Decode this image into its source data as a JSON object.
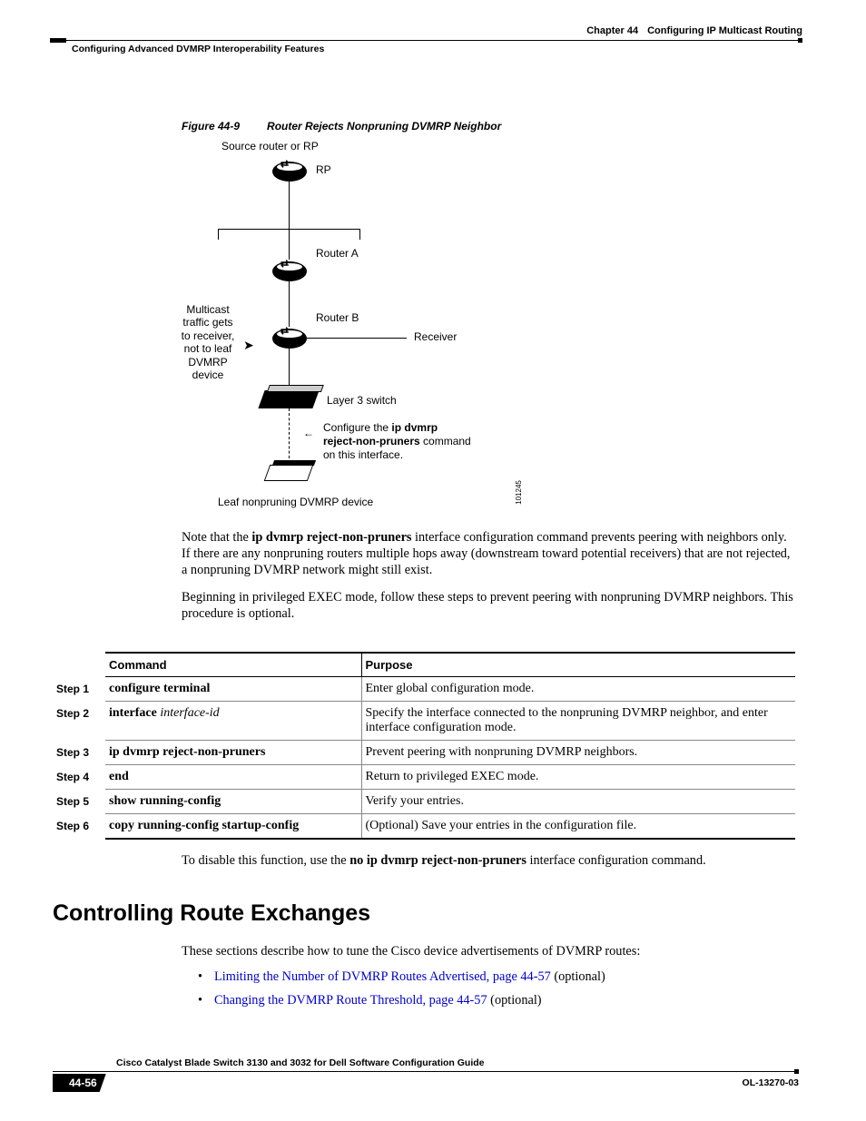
{
  "header": {
    "chapter": "Chapter 44",
    "chapter_title": "Configuring IP Multicast Routing",
    "section": "Configuring Advanced DVMRP Interoperability Features"
  },
  "figure": {
    "label": "Figure 44-9",
    "title": "Router Rejects Nonpruning DVMRP Neighbor",
    "top_label": "Source router or RP",
    "rp": "RP",
    "router_a": "Router A",
    "router_b": "Router B",
    "receiver": "Receiver",
    "left_note_l1": "Multicast",
    "left_note_l2": "traffic gets",
    "left_note_l3": "to receiver,",
    "left_note_l4": "not to leaf",
    "left_note_l5": "DVMRP",
    "left_note_l6": "device",
    "l3_switch": "Layer 3 switch",
    "config_l1_pre": "Configure the ",
    "config_l1_bold": "ip dvmrp",
    "config_l2_bold": "reject-non-pruners",
    "config_l2_post": " command",
    "config_l3": "on this interface.",
    "leaf": "Leaf nonpruning DVMRP device",
    "imgid": "101245"
  },
  "para1_pre": "Note that the ",
  "para1_bold": "ip dvmrp reject-non-pruners",
  "para1_post": " interface configuration command prevents peering with neighbors only. If there are any nonpruning routers multiple hops away (downstream toward potential receivers) that are not rejected, a nonpruning DVMRP network might still exist.",
  "para2": "Beginning in privileged EXEC mode, follow these steps to prevent peering with nonpruning DVMRP neighbors. This procedure is optional.",
  "table": {
    "h_command": "Command",
    "h_purpose": "Purpose",
    "rows": [
      {
        "step": "Step 1",
        "cmd_b": "configure terminal",
        "cmd_i": "",
        "purpose": "Enter global configuration mode."
      },
      {
        "step": "Step 2",
        "cmd_b": "interface ",
        "cmd_i": "interface-id",
        "purpose": "Specify the interface connected to the nonpruning DVMRP neighbor, and enter interface configuration mode."
      },
      {
        "step": "Step 3",
        "cmd_b": "ip dvmrp reject-non-pruners",
        "cmd_i": "",
        "purpose": "Prevent peering with nonpruning DVMRP neighbors."
      },
      {
        "step": "Step 4",
        "cmd_b": "end",
        "cmd_i": "",
        "purpose": "Return to privileged EXEC mode."
      },
      {
        "step": "Step 5",
        "cmd_b": "show running-config",
        "cmd_i": "",
        "purpose": "Verify your entries."
      },
      {
        "step": "Step 6",
        "cmd_b": "copy running-config startup-config",
        "cmd_i": "",
        "purpose": "(Optional) Save your entries in the configuration file."
      }
    ]
  },
  "para3_pre": "To disable this function, use the ",
  "para3_bold": "no ip dvmrp reject-non-pruners",
  "para3_post": " interface configuration command.",
  "h2": "Controlling Route Exchanges",
  "para4": "These sections describe how to tune the Cisco device advertisements of DVMRP routes:",
  "bullets": [
    {
      "link": "Limiting the Number of DVMRP Routes Advertised, page 44-57",
      "post": " (optional)"
    },
    {
      "link": "Changing the DVMRP Route Threshold, page 44-57",
      "post": " (optional)"
    }
  ],
  "footer": {
    "guide": "Cisco Catalyst Blade Switch 3130 and 3032 for Dell Software Configuration Guide",
    "page": "44-56",
    "docid": "OL-13270-03"
  }
}
